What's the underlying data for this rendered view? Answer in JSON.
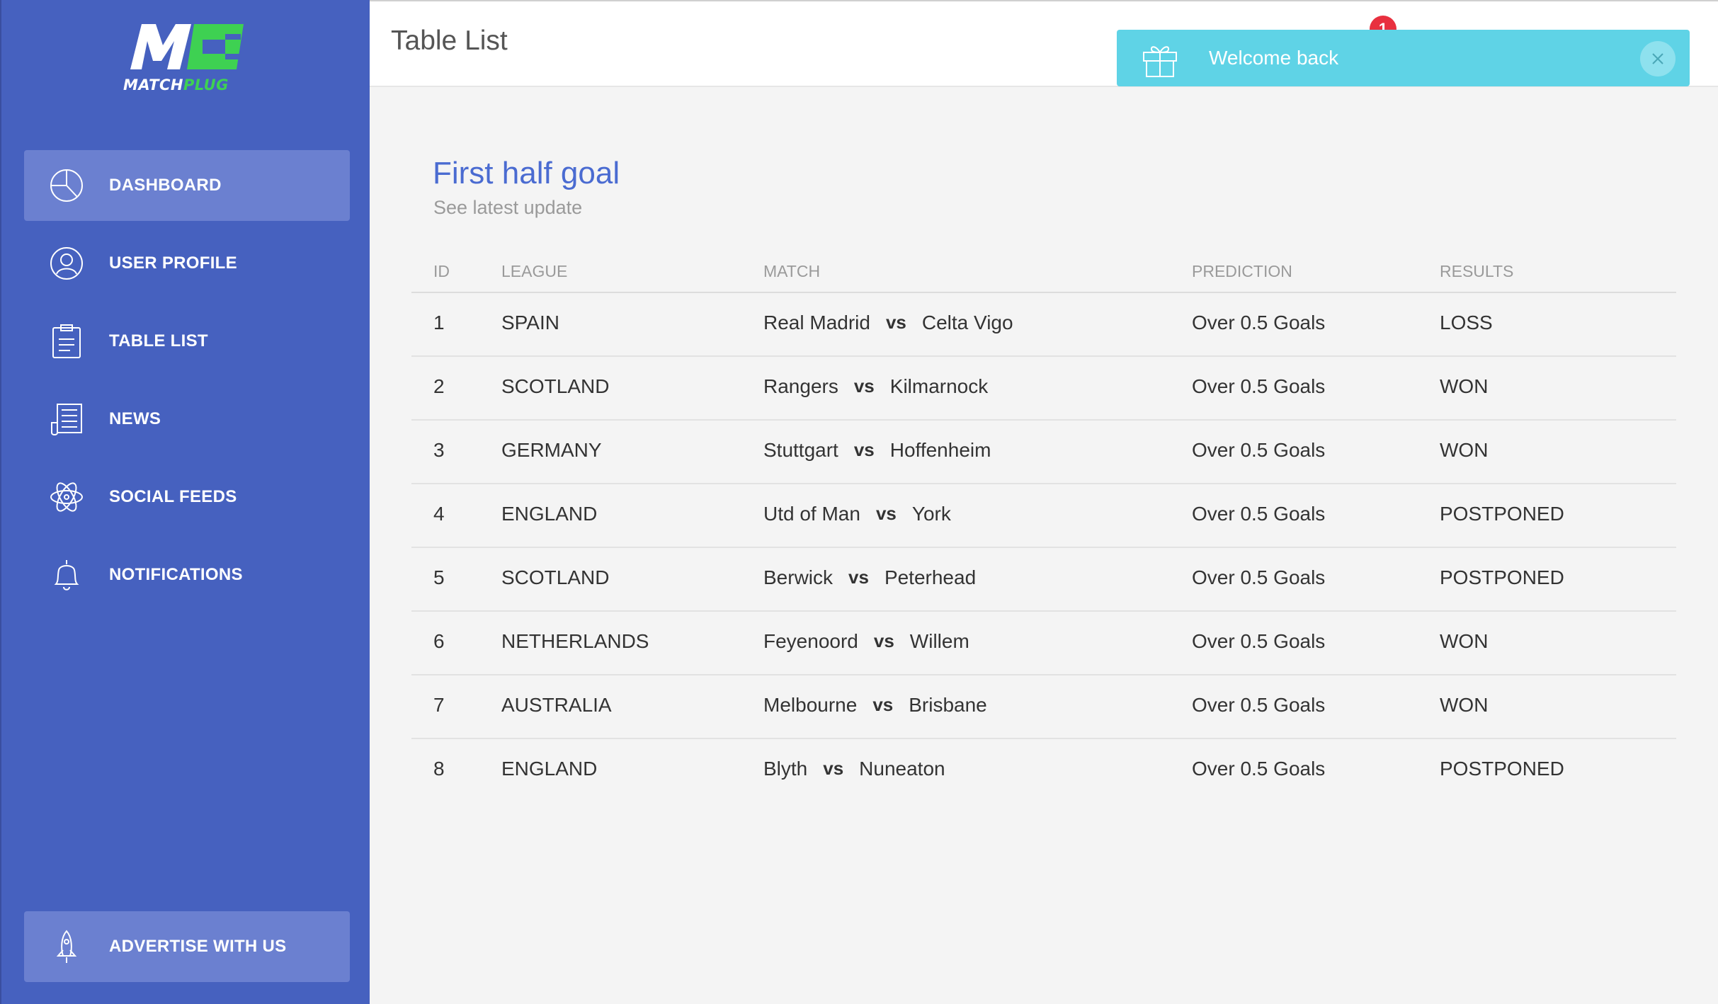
{
  "brand": {
    "logo_letters": "M",
    "word1": "MATCH",
    "word2": "PLUG",
    "accent_green": "#3ed152",
    "sidebar_color": "#4661bf"
  },
  "sidebar": {
    "items": [
      {
        "label": "DASHBOARD",
        "icon": "pie-chart-icon",
        "active": true
      },
      {
        "label": "USER PROFILE",
        "icon": "user-icon",
        "active": false
      },
      {
        "label": "TABLE LIST",
        "icon": "clipboard-icon",
        "active": false
      },
      {
        "label": "NEWS",
        "icon": "newspaper-icon",
        "active": false
      },
      {
        "label": "SOCIAL FEEDS",
        "icon": "atom-icon",
        "active": false
      },
      {
        "label": "NOTIFICATIONS",
        "icon": "bell-icon",
        "active": false
      }
    ],
    "advertise": {
      "label": "ADVERTISE WITH US",
      "icon": "rocket-icon"
    }
  },
  "header": {
    "title": "Table List",
    "notification_count": "1"
  },
  "toast": {
    "message": "Welcome back",
    "icon": "gift-icon",
    "color": "#5fd3e6"
  },
  "card": {
    "title": "First half goal",
    "subtitle": "See latest update",
    "columns": [
      "ID",
      "LEAGUE",
      "MATCH",
      "PREDICTION",
      "RESULTS"
    ],
    "vs_label": "vs",
    "rows": [
      {
        "id": "1",
        "league": "SPAIN",
        "home": "Real Madrid",
        "away": "Celta Vigo",
        "prediction": "Over 0.5 Goals",
        "result": "LOSS"
      },
      {
        "id": "2",
        "league": "SCOTLAND",
        "home": "Rangers",
        "away": "Kilmarnock",
        "prediction": "Over 0.5 Goals",
        "result": "WON"
      },
      {
        "id": "3",
        "league": "GERMANY",
        "home": "Stuttgart",
        "away": "Hoffenheim",
        "prediction": "Over 0.5 Goals",
        "result": "WON"
      },
      {
        "id": "4",
        "league": "ENGLAND",
        "home": "Utd of Man",
        "away": "York",
        "prediction": "Over 0.5 Goals",
        "result": "POSTPONED"
      },
      {
        "id": "5",
        "league": "SCOTLAND",
        "home": "Berwick",
        "away": "Peterhead",
        "prediction": "Over 0.5 Goals",
        "result": "POSTPONED"
      },
      {
        "id": "6",
        "league": "NETHERLANDS",
        "home": "Feyenoord",
        "away": "Willem",
        "prediction": "Over 0.5 Goals",
        "result": "WON"
      },
      {
        "id": "7",
        "league": "AUSTRALIA",
        "home": "Melbourne",
        "away": "Brisbane",
        "prediction": "Over 0.5 Goals",
        "result": "WON"
      },
      {
        "id": "8",
        "league": "ENGLAND",
        "home": "Blyth",
        "away": "Nuneaton",
        "prediction": "Over 0.5 Goals",
        "result": "POSTPONED"
      }
    ]
  }
}
